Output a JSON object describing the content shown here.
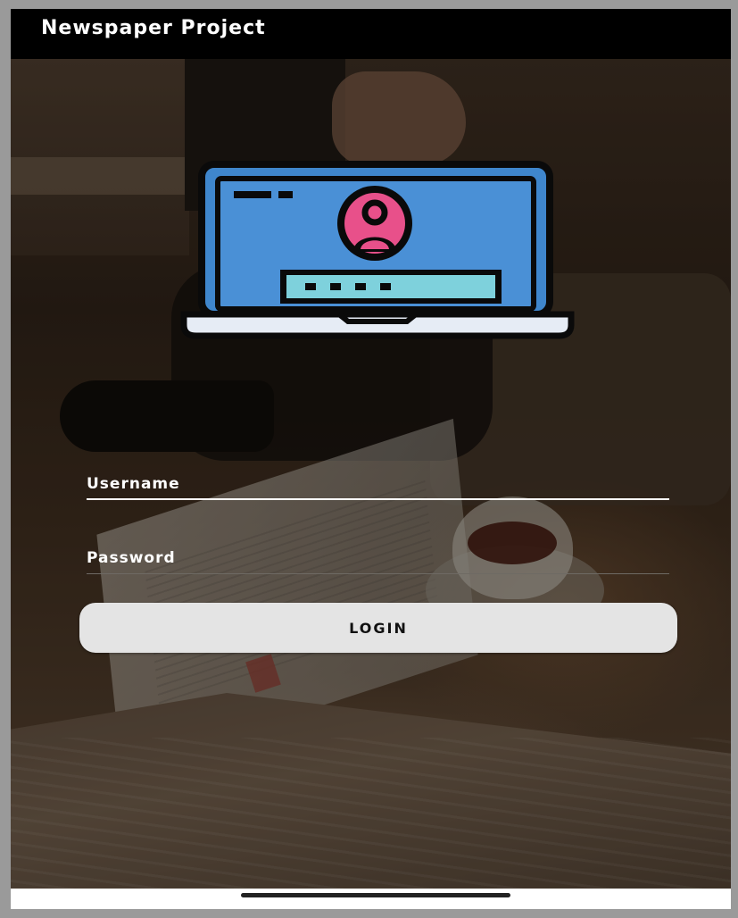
{
  "app_bar": {
    "title": "Newspaper Project"
  },
  "illustration": {
    "icon": "laptop-login-icon",
    "colors": {
      "screen": "#3f86cc",
      "avatar_circle": "#e8508a",
      "password_bar": "#7ed1dc",
      "outline": "#0a0a0a",
      "base": "#e6ecf5"
    }
  },
  "form": {
    "username_placeholder": "Username",
    "password_placeholder": "Password",
    "login_label": "LOGIN"
  },
  "colors": {
    "app_bar_bg": "#000000",
    "button_bg": "#e4e4e4",
    "text_light": "#ffffff"
  }
}
